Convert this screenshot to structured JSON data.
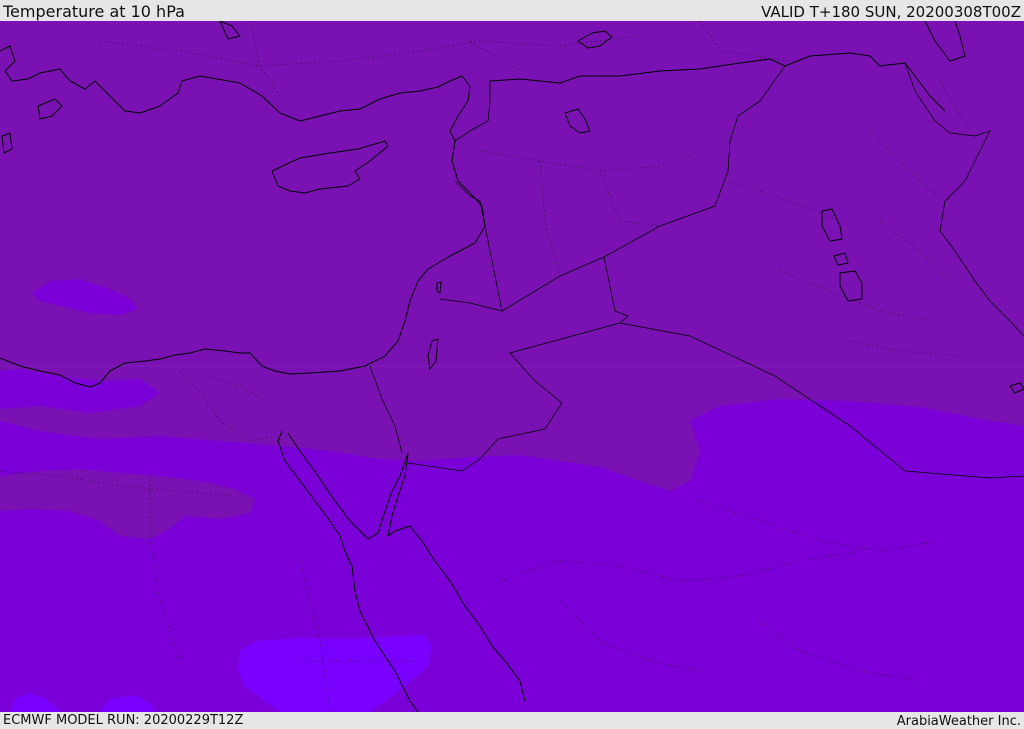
{
  "header": {
    "title": "Temperature at 10 hPa",
    "valid": "VALID T+180 SUN, 20200308T00Z"
  },
  "footer": {
    "model_run": "ECMWF MODEL RUN: 20200229T12Z",
    "credit": "ArabiaWeather Inc."
  },
  "map": {
    "field_colors": {
      "north_band": "#7a12b3",
      "middle_band": "#7b00d8",
      "warmest_band": "#7a00ff",
      "coastline": "#000000"
    }
  }
}
